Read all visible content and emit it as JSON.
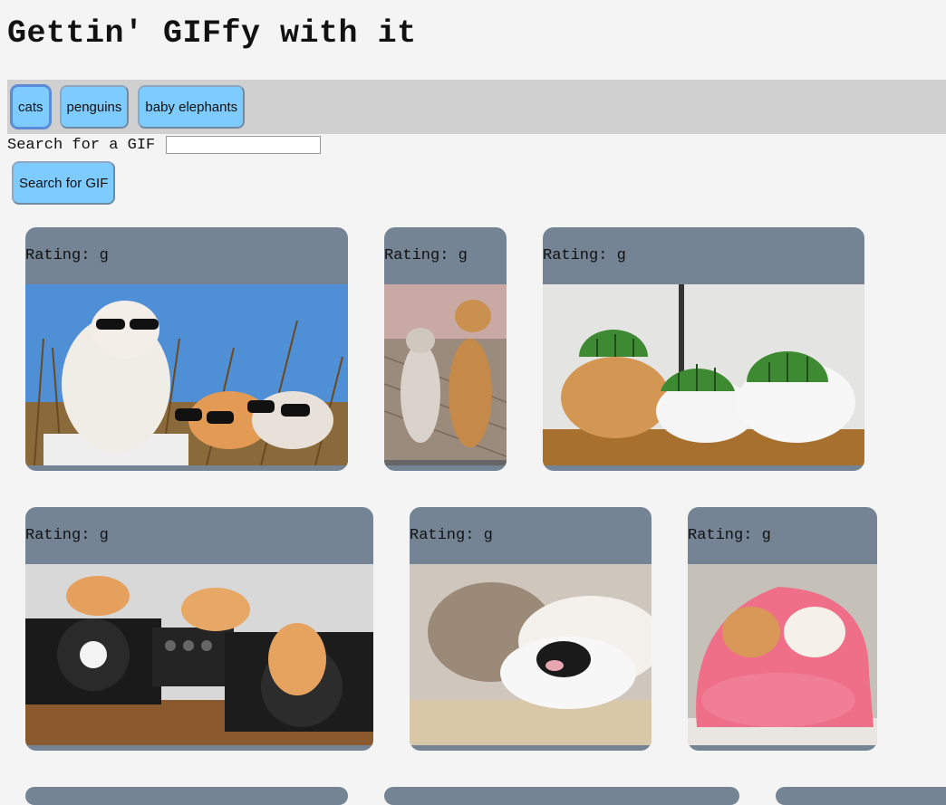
{
  "header": {
    "title": "Gettin' GIFfy with it"
  },
  "topics": [
    {
      "label": "cats",
      "active": true
    },
    {
      "label": "penguins",
      "active": false
    },
    {
      "label": "baby elephants",
      "active": false
    }
  ],
  "search": {
    "label": "Search for a GIF",
    "value": "",
    "placeholder": "",
    "button_label": "Search for GIF"
  },
  "gifs": [
    {
      "rating": "Rating: g",
      "subject": "cats wearing sunglasses"
    },
    {
      "rating": "Rating: g",
      "subject": "two kittens standing"
    },
    {
      "rating": "Rating: g",
      "subject": "cats with watermelon helmets"
    },
    {
      "rating": "Rating: g",
      "subject": "kittens on DJ turntables"
    },
    {
      "rating": "Rating: g",
      "subject": "cats cuddling"
    },
    {
      "rating": "Rating: g",
      "subject": "cats in pink hood"
    },
    {
      "rating": "",
      "subject": ""
    },
    {
      "rating": "",
      "subject": ""
    },
    {
      "rating": "",
      "subject": ""
    }
  ],
  "colors": {
    "accent_button": "#7ecbff",
    "card": "#748494",
    "topic_bar": "#d0d0d0",
    "page_background": "#f4f4f4"
  }
}
